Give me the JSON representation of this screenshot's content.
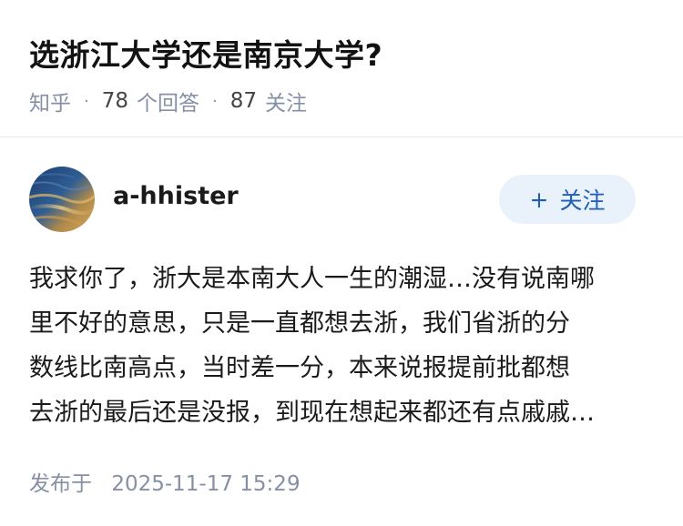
{
  "question": {
    "title": "选浙江大学还是南京大学?",
    "meta": {
      "source": "知乎",
      "answer_count": "78",
      "answer_label": "个回答",
      "follower_count": "87",
      "follower_label": "关注",
      "separator": "·"
    }
  },
  "answer": {
    "author": {
      "name": "a-hhister",
      "avatar_icon": "avatar-image"
    },
    "follow_button": {
      "icon": "+",
      "label": "关注"
    },
    "content_lines": [
      "我求你了，浙大是本南大人一生的潮湿…没有说南哪",
      "里不好的意思，只是一直都想去浙，我们省浙的分",
      "数线比南高点，当时差一分，本来说报提前批都想",
      "去浙的最后还是没报，到现在想起来都还有点戚戚…"
    ],
    "published": {
      "label": "发布于",
      "timestamp": "2025-11-17 15:29"
    }
  },
  "colors": {
    "meta_gray": "#8590a6",
    "follow_bg": "#e9f1fb",
    "follow_text": "#1e5fb3"
  }
}
